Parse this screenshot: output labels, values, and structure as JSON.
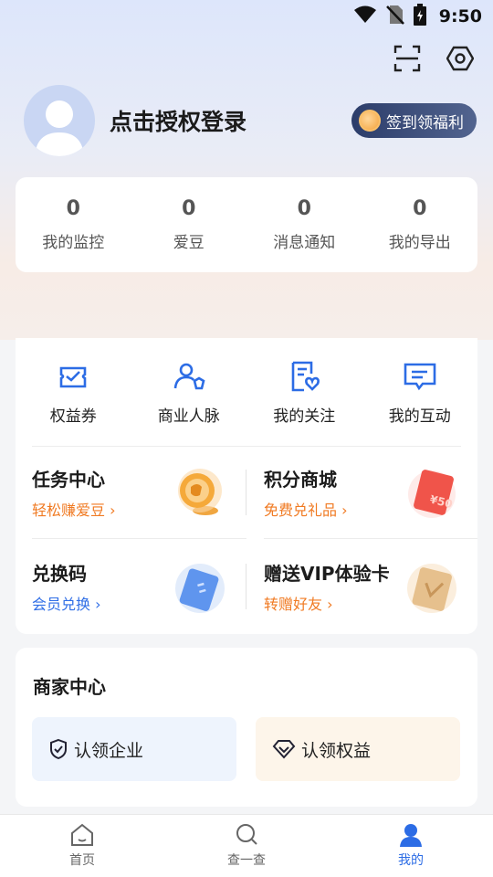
{
  "status_bar": {
    "time": "9:50",
    "icons": [
      "wifi-icon",
      "no-sim-icon",
      "battery-icon"
    ]
  },
  "header": {
    "actions": [
      "scan-icon",
      "settings-icon"
    ]
  },
  "profile": {
    "login_text": "点击授权登录",
    "signin_label": "签到领福利"
  },
  "stats": [
    {
      "value": "0",
      "label": "我的监控"
    },
    {
      "value": "0",
      "label": "爱豆"
    },
    {
      "value": "0",
      "label": "消息通知"
    },
    {
      "value": "0",
      "label": "我的导出"
    }
  ],
  "quick_links": [
    {
      "label": "权益券",
      "icon": "coupon-icon"
    },
    {
      "label": "商业人脉",
      "icon": "contacts-icon"
    },
    {
      "label": "我的关注",
      "icon": "follow-icon"
    },
    {
      "label": "我的互动",
      "icon": "chat-icon"
    }
  ],
  "tiles": [
    {
      "title": "任务中心",
      "subtitle": "轻松赚爱豆",
      "icon": "coin-stack-icon"
    },
    {
      "title": "积分商城",
      "subtitle": "免费兑礼品",
      "icon": "red-envelope-icon"
    },
    {
      "title": "兑换码",
      "subtitle": "会员兑换",
      "icon": "card-icon"
    },
    {
      "title": "赠送VIP体验卡",
      "subtitle": "转赠好友",
      "icon": "vip-card-icon"
    }
  ],
  "merchant": {
    "title": "商家中心",
    "claim_company": "认领企业",
    "claim_rights": "认领权益"
  },
  "tabbar": [
    {
      "label": "首页",
      "icon": "home-icon"
    },
    {
      "label": "查一查",
      "icon": "search-icon"
    },
    {
      "label": "我的",
      "icon": "user-icon",
      "active": true
    }
  ],
  "colors": {
    "accent": "#2c6ce5",
    "orange": "#f07a22",
    "blue_text": "#2f6ee6"
  }
}
